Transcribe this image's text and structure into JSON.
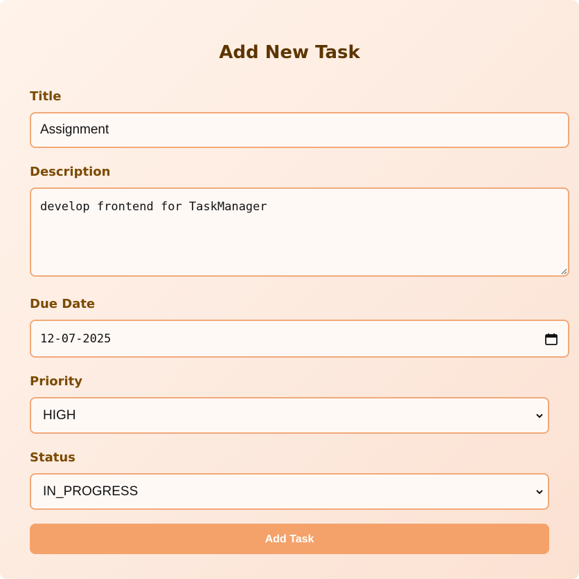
{
  "form": {
    "heading": "Add New Task",
    "title_label": "Title",
    "title_value": "Assignment",
    "description_label": "Description",
    "description_value": "develop frontend for TaskManager",
    "due_date_label": "Due Date",
    "due_date_value": "12-07-2025",
    "priority_label": "Priority",
    "priority_value": "HIGH",
    "status_label": "Status",
    "status_value": "IN_PROGRESS",
    "submit_label": "Add Task"
  },
  "colors": {
    "accent": "#f4a26a",
    "border": "#f2a878",
    "heading": "#5c3500",
    "label": "#7a4a00"
  },
  "icons": {
    "date_picker": "calendar-icon",
    "select_arrow": "chevron-down-icon",
    "textarea_resize": "resize-handle-icon"
  }
}
